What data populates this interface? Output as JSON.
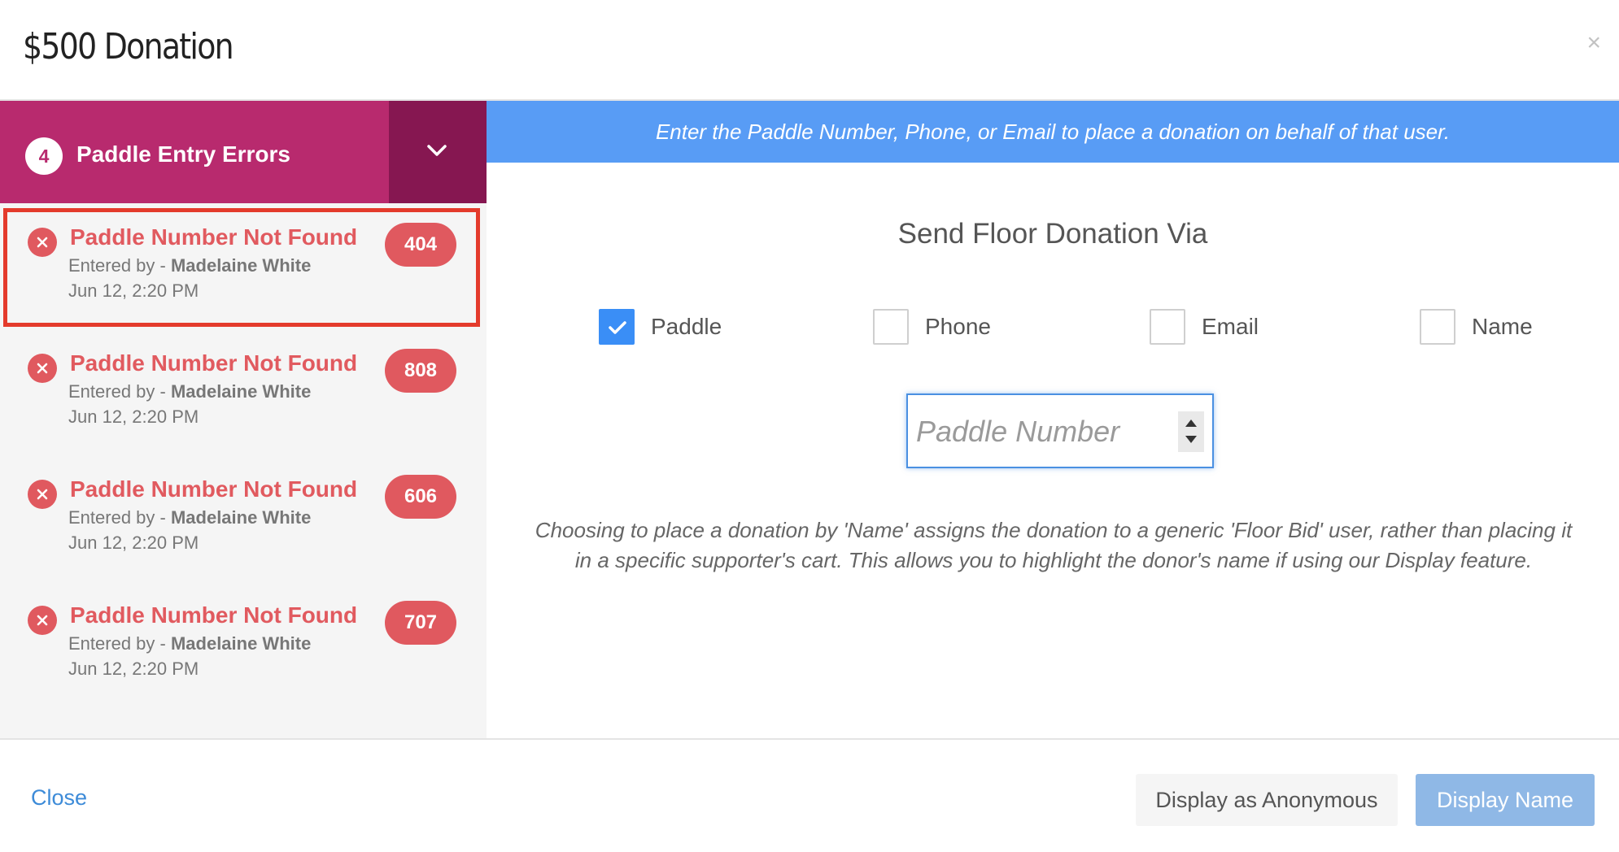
{
  "modal": {
    "title": "$500 Donation",
    "close_symbol": "×"
  },
  "errors_panel": {
    "count": "4",
    "header_label": "Paddle Entry Errors",
    "toggle_icon": "chevron-down-icon",
    "colors": {
      "header_bg": "#b82a6e",
      "toggle_bg": "#861751",
      "error_red": "#e0595f",
      "selection_outline": "#e43b2c"
    },
    "items": [
      {
        "title": "Paddle Number Not Found",
        "entered_prefix": "Entered by - ",
        "entered_by": "Madelaine White",
        "date": "Jun 12, 2:20 PM",
        "badge": "404",
        "selected": true
      },
      {
        "title": "Paddle Number Not Found",
        "entered_prefix": "Entered by - ",
        "entered_by": "Madelaine White",
        "date": "Jun 12, 2:20 PM",
        "badge": "808",
        "selected": false
      },
      {
        "title": "Paddle Number Not Found",
        "entered_prefix": "Entered by - ",
        "entered_by": "Madelaine White",
        "date": "Jun 12, 2:20 PM",
        "badge": "606",
        "selected": false
      },
      {
        "title": "Paddle Number Not Found",
        "entered_prefix": "Entered by - ",
        "entered_by": "Madelaine White",
        "date": "Jun 12, 2:20 PM",
        "badge": "707",
        "selected": false
      }
    ]
  },
  "main": {
    "banner_text": "Enter the Paddle Number, Phone, or Email to place a donation on behalf of that user.",
    "banner_color": "#589cf5",
    "send_title": "Send Floor Donation Via",
    "options": [
      {
        "label": "Paddle",
        "checked": true
      },
      {
        "label": "Phone",
        "checked": false
      },
      {
        "label": "Email",
        "checked": false
      },
      {
        "label": "Name",
        "checked": false
      }
    ],
    "input": {
      "placeholder": "Paddle Number",
      "value": ""
    },
    "note": "Choosing to place a donation by 'Name' assigns the donation to a generic 'Floor Bid' user, rather than placing it in a specific supporter's cart. This allows you to highlight the donor's name if using our Display feature."
  },
  "footer": {
    "close_label": "Close",
    "anonymous_label": "Display as Anonymous",
    "display_name_label": "Display Name"
  }
}
